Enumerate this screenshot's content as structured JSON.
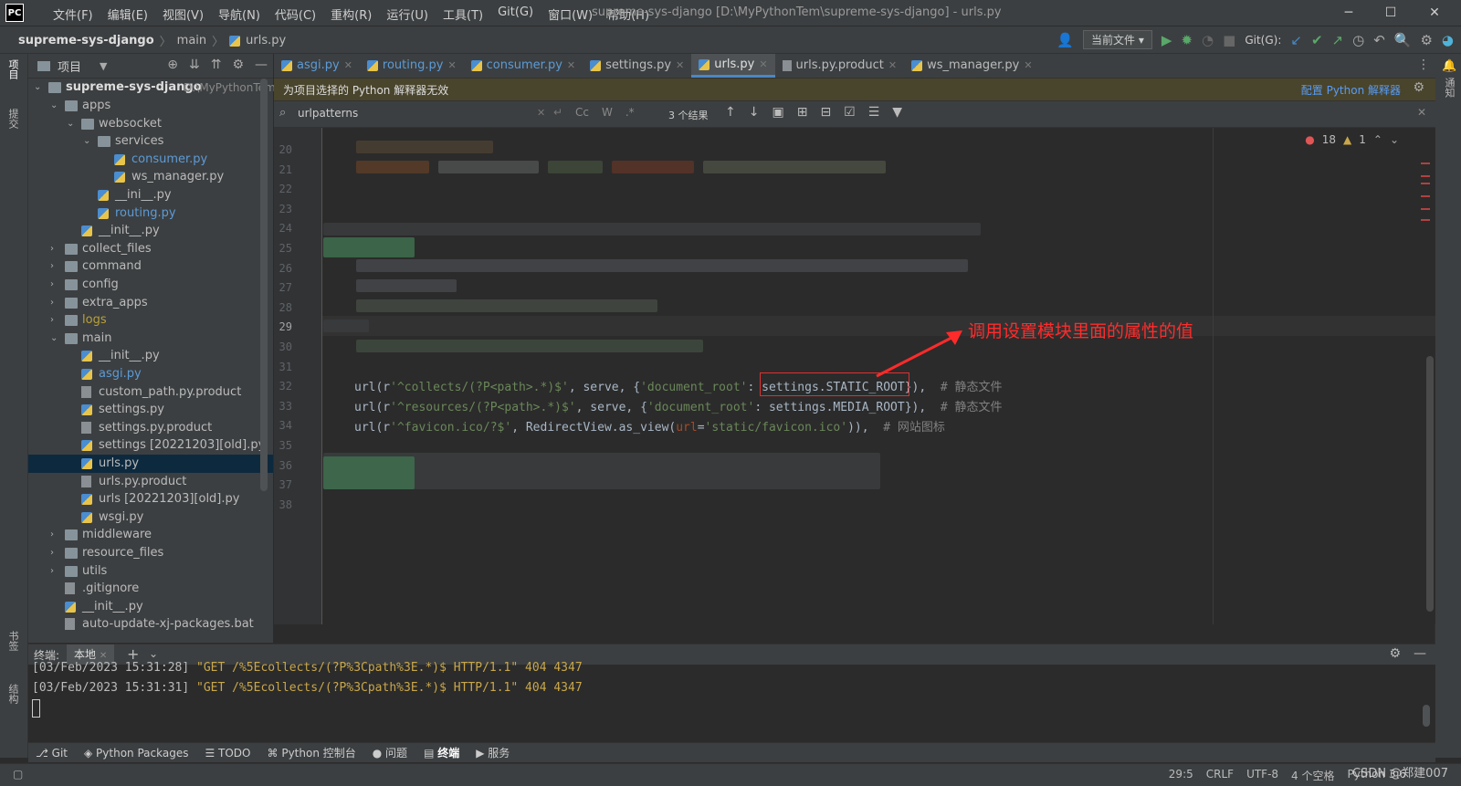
{
  "window": {
    "title": "supreme-sys-django [D:\\MyPythonTem\\supreme-sys-django] - urls.py",
    "menu": [
      "文件(F)",
      "编辑(E)",
      "视图(V)",
      "导航(N)",
      "代码(C)",
      "重构(R)",
      "运行(U)",
      "工具(T)",
      "Git(G)",
      "窗口(W)",
      "帮助(H)"
    ],
    "logo": "PC"
  },
  "breadcrumb": [
    "supreme-sys-django",
    "main",
    "urls.py"
  ],
  "toolbar": {
    "run_config": "当前文件",
    "git_label": "Git(G):"
  },
  "left_strip": {
    "project": "项目",
    "commit": "提交",
    "bookmarks": "书签",
    "structure": "结构"
  },
  "right_strip": {
    "notifications": "通知"
  },
  "project_panel": {
    "title": "项目",
    "root_name": "supreme-sys-django",
    "root_path": "D:\\MyPythonTem",
    "items": [
      {
        "label": "apps",
        "depth": 1,
        "type": "folder",
        "open": true
      },
      {
        "label": "websocket",
        "depth": 2,
        "type": "folder",
        "open": true
      },
      {
        "label": "services",
        "depth": 3,
        "type": "folder",
        "open": true
      },
      {
        "label": "consumer.py",
        "depth": 4,
        "type": "py",
        "color": "blue"
      },
      {
        "label": "ws_manager.py",
        "depth": 4,
        "type": "py"
      },
      {
        "label": "__ini__.py",
        "depth": 3,
        "type": "py"
      },
      {
        "label": "routing.py",
        "depth": 3,
        "type": "py",
        "color": "blue"
      },
      {
        "label": "__init__.py",
        "depth": 2,
        "type": "py"
      },
      {
        "label": "collect_files",
        "depth": 1,
        "type": "folder",
        "open": false
      },
      {
        "label": "command",
        "depth": 1,
        "type": "folder",
        "open": false
      },
      {
        "label": "config",
        "depth": 1,
        "type": "folder",
        "open": false
      },
      {
        "label": "extra_apps",
        "depth": 1,
        "type": "folder",
        "open": false
      },
      {
        "label": "logs",
        "depth": 1,
        "type": "folder",
        "open": false,
        "color": "orange"
      },
      {
        "label": "main",
        "depth": 1,
        "type": "folder",
        "open": true
      },
      {
        "label": "__init__.py",
        "depth": 2,
        "type": "py"
      },
      {
        "label": "asgi.py",
        "depth": 2,
        "type": "py",
        "color": "blue"
      },
      {
        "label": "custom_path.py.product",
        "depth": 2,
        "type": "file"
      },
      {
        "label": "settings.py",
        "depth": 2,
        "type": "py"
      },
      {
        "label": "settings.py.product",
        "depth": 2,
        "type": "file"
      },
      {
        "label": "settings [20221203][old].py",
        "depth": 2,
        "type": "py"
      },
      {
        "label": "urls.py",
        "depth": 2,
        "type": "py",
        "selected": true
      },
      {
        "label": "urls.py.product",
        "depth": 2,
        "type": "file"
      },
      {
        "label": "urls [20221203][old].py",
        "depth": 2,
        "type": "py"
      },
      {
        "label": "wsgi.py",
        "depth": 2,
        "type": "py"
      },
      {
        "label": "middleware",
        "depth": 1,
        "type": "folder",
        "open": false
      },
      {
        "label": "resource_files",
        "depth": 1,
        "type": "folder",
        "open": false
      },
      {
        "label": "utils",
        "depth": 1,
        "type": "folder",
        "open": false
      },
      {
        "label": ".gitignore",
        "depth": 1,
        "type": "file"
      },
      {
        "label": "__init__.py",
        "depth": 1,
        "type": "py"
      },
      {
        "label": "auto-update-xj-packages.bat",
        "depth": 1,
        "type": "file"
      }
    ]
  },
  "tabs": [
    {
      "label": "asgi.py",
      "type": "py",
      "color": "blue"
    },
    {
      "label": "routing.py",
      "type": "py",
      "color": "blue"
    },
    {
      "label": "consumer.py",
      "type": "py",
      "color": "blue"
    },
    {
      "label": "settings.py",
      "type": "py"
    },
    {
      "label": "urls.py",
      "type": "py",
      "active": true
    },
    {
      "label": "urls.py.product",
      "type": "file"
    },
    {
      "label": "ws_manager.py",
      "type": "py"
    }
  ],
  "banner": {
    "message": "为项目选择的 Python 解释器无效",
    "action": "配置 Python 解释器"
  },
  "search": {
    "query": "urlpatterns",
    "opt_case": "Cc",
    "opt_word": "W",
    "opt_regex": ".*",
    "result_count": "3 个结果"
  },
  "editor": {
    "line_numbers": [
      "20",
      "21",
      "22",
      "23",
      "24",
      "25",
      "26",
      "27",
      "28",
      "29",
      "30",
      "31",
      "32",
      "33",
      "34",
      "35",
      "36",
      "37",
      "38"
    ],
    "current_line": "29",
    "errors": "18",
    "warnings": "1",
    "code": {
      "l32": {
        "fn": "url(r",
        "pattern": "'^collects/(?P<path>.*)$'",
        "mid": ", serve, {",
        "key": "'document_root'",
        "colon": ": ",
        "val": "settings.STATIC_ROOT",
        "end": "}),  ",
        "comment": "# 静态文件"
      },
      "l33": {
        "fn": "url(r",
        "pattern": "'^resources/(?P<path>.*)$'",
        "mid": ", serve, {",
        "key": "'document_root'",
        "colon": ": ",
        "val": "settings.MEDIA_ROOT",
        "end": "}),  ",
        "comment": "# 静态文件"
      },
      "l34": {
        "fn": "url(r",
        "pattern": "'^favicon.ico/?$'",
        "mid": ", RedirectView.as_view(",
        "param": "url",
        "eq": "=",
        "arg": "'static/favicon.ico'",
        "end": ")),  ",
        "comment": "# 网站图标"
      }
    },
    "annotation": "调用设置模块里面的属性的值"
  },
  "terminal": {
    "title": "终端:",
    "tab": "本地",
    "lines": [
      {
        "ts": "[03/Feb/2023 15:31:28] ",
        "req": "\"GET /%5Ecollects/(?P%3Cpath%3E.*)$ HTTP/1.1\" 404 4347"
      },
      {
        "ts": "[03/Feb/2023 15:31:31] ",
        "req": "\"GET /%5Ecollects/(?P%3Cpath%3E.*)$ HTTP/1.1\" 404 4347"
      }
    ]
  },
  "bottom_tools": [
    "Git",
    "Python Packages",
    "TODO",
    "Python 控制台",
    "问题",
    "终端",
    "服务"
  ],
  "bottom_tools_active": "终端",
  "status": {
    "position": "29:5",
    "line_sep": "CRLF",
    "encoding": "UTF-8",
    "indent": "4 个空格",
    "interpreter": "Python 3.6"
  },
  "watermark": "CSDN @郑建007"
}
